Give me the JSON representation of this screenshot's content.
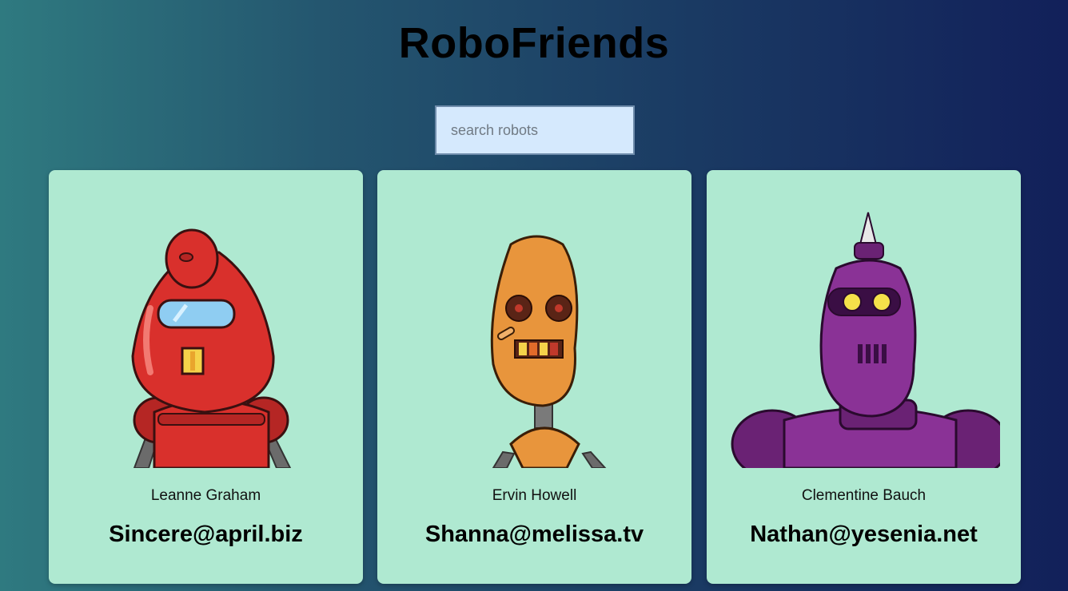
{
  "header": {
    "title": "RoboFriends"
  },
  "search": {
    "placeholder": "search robots",
    "value": ""
  },
  "robots": [
    {
      "name": "Leanne Graham",
      "email": "Sincere@april.biz",
      "color": "#d9302c"
    },
    {
      "name": "Ervin Howell",
      "email": "Shanna@melissa.tv",
      "color": "#e8953c"
    },
    {
      "name": "Clementine Bauch",
      "email": "Nathan@yesenia.net",
      "color": "#7a2a86"
    }
  ],
  "colors": {
    "card_background": "#afe9d1",
    "search_background": "#d5e9fd"
  }
}
